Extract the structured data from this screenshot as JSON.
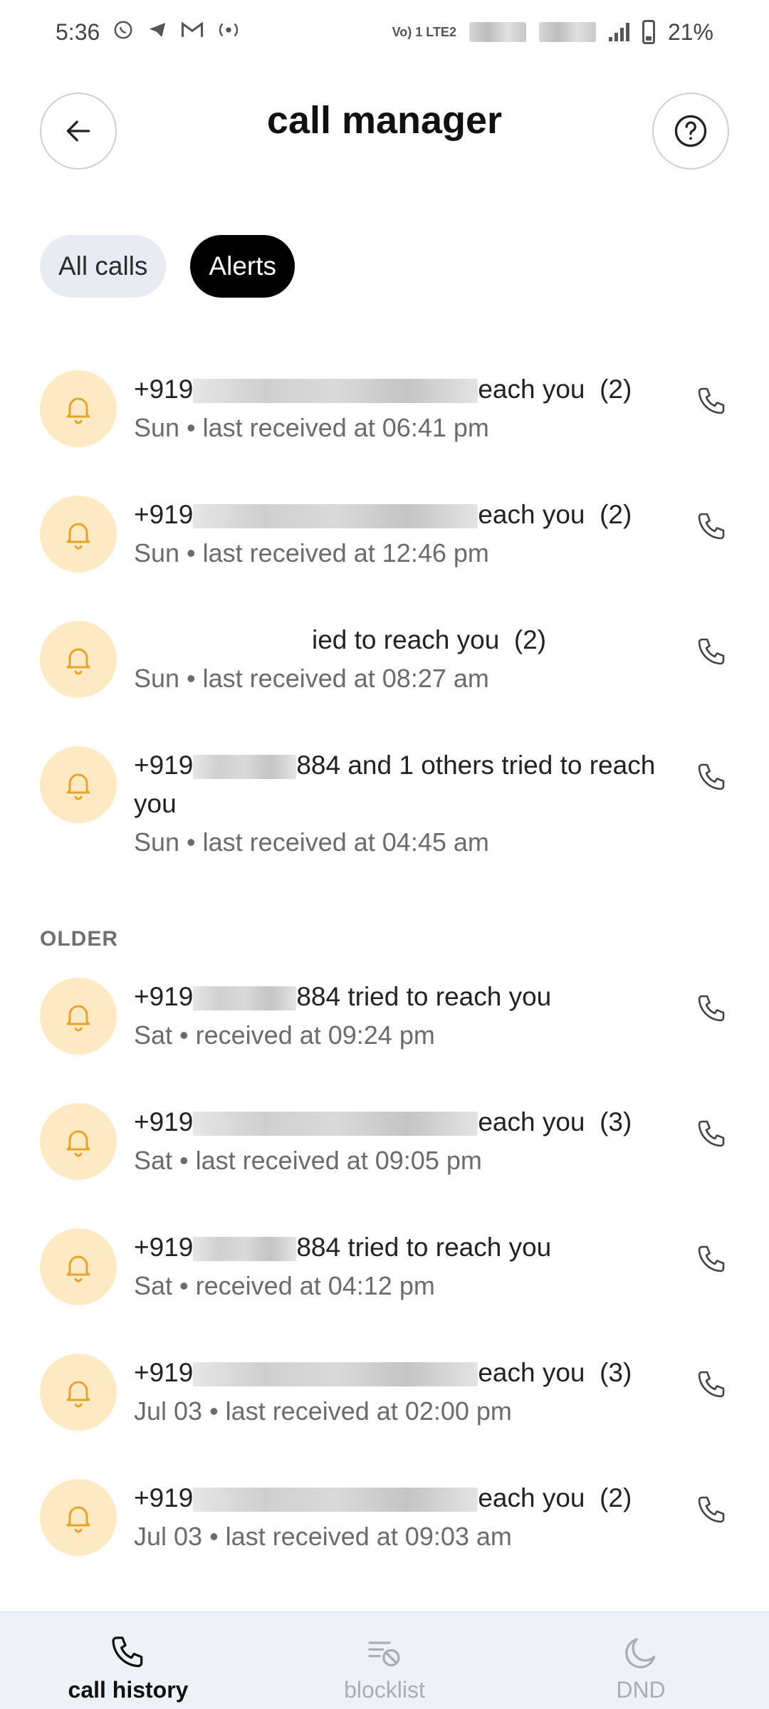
{
  "status_bar": {
    "time": "5:36",
    "battery": "21%",
    "network_label": "Vo) 1 LTE2",
    "icons": [
      "whatsapp-icon",
      "telegram-icon",
      "gmail-icon",
      "hotspot-icon"
    ]
  },
  "header": {
    "title": "call manager"
  },
  "chips": {
    "all_calls": "All calls",
    "alerts": "Alerts",
    "selected": "Alerts"
  },
  "alerts": [
    {
      "prefix": "+919",
      "suffix": "each you",
      "count": "(2)",
      "subtitle": "Sun • last received at 06:41 pm"
    },
    {
      "prefix": "+919",
      "suffix": "each you",
      "count": "(2)",
      "subtitle": "Sun • last received at 12:46 pm"
    },
    {
      "prefix": "",
      "suffix": "ied to reach you",
      "count": "(2)",
      "subtitle": "Sun • last received at 08:27 am"
    },
    {
      "prefix": "+919",
      "suffix": "884 and 1 others tried to reach you",
      "count": "",
      "subtitle": "Sun • last received at 04:45 am"
    }
  ],
  "older_label": "OLDER",
  "older_alerts": [
    {
      "prefix": "+919",
      "suffix": "884 tried to reach you",
      "count": "",
      "subtitle": "Sat • received at 09:24 pm"
    },
    {
      "prefix": "+919",
      "suffix": "each you",
      "count": "(3)",
      "subtitle": "Sat • last received at 09:05 pm"
    },
    {
      "prefix": "+919",
      "suffix": "884 tried to reach you",
      "count": "",
      "subtitle": "Sat • received at 04:12 pm"
    },
    {
      "prefix": "+919",
      "suffix": "each you",
      "count": "(3)",
      "subtitle": "Jul 03 • last received at 02:00 pm"
    },
    {
      "prefix": "+919",
      "suffix": "each you",
      "count": "(2)",
      "subtitle": "Jul 03 • last received at 09:03 am"
    }
  ],
  "bottom_nav": {
    "call_history": "call history",
    "blocklist": "blocklist",
    "dnd": "DND",
    "active": "call history"
  }
}
